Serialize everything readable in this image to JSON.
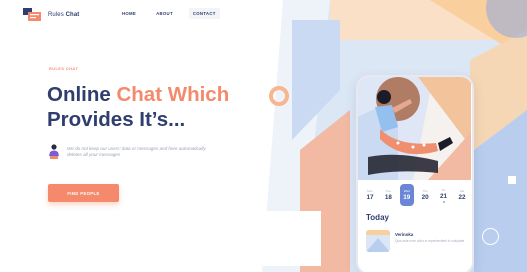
{
  "brand": {
    "name_part1": "Rules",
    "name_part2": "Chat",
    "logo_icon": "flag-chat-logo-icon",
    "colors": {
      "accent": "#f4896b",
      "navy": "#2f3e6e",
      "blue": "#6b86d6"
    }
  },
  "nav": {
    "items": [
      {
        "label": "HOME"
      },
      {
        "label": "ABOUT"
      },
      {
        "label": "CONTACT"
      }
    ]
  },
  "hero": {
    "eyebrow": "RULES CHAT",
    "headline_1": "Online ",
    "headline_highlight": "Chat Which",
    "headline_2": "Provides It’s...",
    "note": "We do not keep our users' data or messages and here automatically deletes all your messages",
    "cta_label": "FIND PEOPLE"
  },
  "phone": {
    "days": [
      {
        "name": "Mon",
        "num": "17",
        "active": false
      },
      {
        "name": "Tue",
        "num": "18",
        "active": false
      },
      {
        "name": "Wed",
        "num": "19",
        "active": true
      },
      {
        "name": "Thu",
        "num": "20",
        "active": false
      },
      {
        "name": "Fri",
        "num": "21",
        "active": false
      },
      {
        "name": "Sat",
        "num": "22",
        "active": false
      }
    ],
    "today_label": "Today",
    "item_title": "Verinoka",
    "item_text": "Quis aute irure dolor in reprehenderit in voluptate"
  }
}
